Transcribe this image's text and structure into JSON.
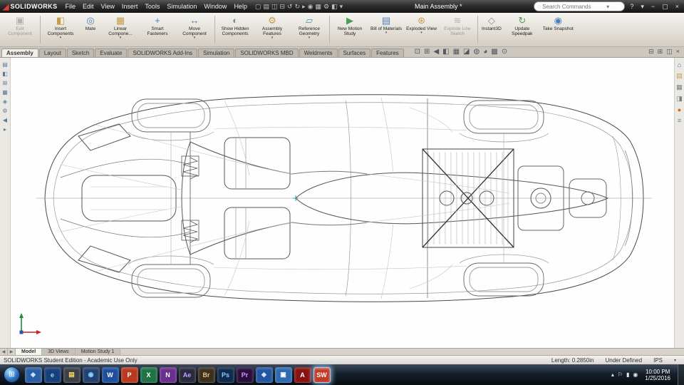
{
  "app": {
    "brand": "SOLIDWORKS",
    "title": "Main Assembly *"
  },
  "menubar": {
    "items": [
      "File",
      "Edit",
      "View",
      "Insert",
      "Tools",
      "Simulation",
      "Window",
      "Help"
    ]
  },
  "quickbar": {
    "icons": [
      {
        "name": "new",
        "glyph": "▢"
      },
      {
        "name": "open",
        "glyph": "▤"
      },
      {
        "name": "save",
        "glyph": "◫"
      },
      {
        "name": "print",
        "glyph": "⊟"
      },
      {
        "name": "undo",
        "glyph": "↺"
      },
      {
        "name": "redo",
        "glyph": "↻"
      },
      {
        "name": "select",
        "glyph": "▸"
      },
      {
        "name": "rebuild",
        "glyph": "◉"
      },
      {
        "name": "file-properties",
        "glyph": "▦"
      },
      {
        "name": "options",
        "glyph": "⚙"
      },
      {
        "name": "appearance",
        "glyph": "◧"
      },
      {
        "name": "more",
        "glyph": "▾"
      }
    ]
  },
  "search": {
    "placeholder": "Search Commands",
    "icon": "◌",
    "caret": "▾"
  },
  "window_controls": {
    "help": "?",
    "help_caret": "▾",
    "minimize": "−",
    "restore": "▢",
    "close": "×"
  },
  "ribbon": {
    "buttons": [
      {
        "label": "Edit Component",
        "glyph": "▣",
        "color": "#8a8f94"
      },
      {
        "label": "Insert Components",
        "glyph": "◧",
        "color": "#c79b4a"
      },
      {
        "label": "Mate",
        "glyph": "◎",
        "color": "#4a7ebb"
      },
      {
        "label": "Linear Compone...",
        "glyph": "▦",
        "color": "#c79b4a"
      },
      {
        "label": "Smart Fasteners",
        "glyph": "+",
        "color": "#4a7ebb"
      },
      {
        "label": "Move Component",
        "glyph": "↔",
        "color": "#4a7ebb"
      },
      {
        "label": "Show Hidden Components",
        "glyph": "◐",
        "color": "#7d8a99"
      },
      {
        "label": "Assembly Features",
        "glyph": "⚙",
        "color": "#c79b4a"
      },
      {
        "label": "Reference Geometry",
        "glyph": "▱",
        "color": "#3f9bb3"
      },
      {
        "label": "New Motion Study",
        "glyph": "▶",
        "color": "#4a9e5c"
      },
      {
        "label": "Bill of Materials",
        "glyph": "▤",
        "color": "#4a7ebb"
      },
      {
        "label": "Exploded View",
        "glyph": "⊛",
        "color": "#c79b4a"
      },
      {
        "label": "Explode Line Sketch",
        "glyph": "≋",
        "color": "#9aa0a6"
      },
      {
        "label": "Instant3D",
        "glyph": "◇",
        "color": "#8a8f94"
      },
      {
        "label": "Update Speedpak",
        "glyph": "↻",
        "color": "#4a9e5c"
      },
      {
        "label": "Take Snapshot",
        "glyph": "◉",
        "color": "#4a7ebb"
      }
    ]
  },
  "tabs": {
    "items": [
      "Assembly",
      "Layout",
      "Sketch",
      "Evaluate",
      "SOLIDWORKS Add-Ins",
      "Simulation",
      "SOLIDWORKS MBD",
      "Weldments",
      "Surfaces",
      "Features"
    ]
  },
  "headsup": {
    "icons": [
      {
        "name": "zoom-fit",
        "glyph": "⊡"
      },
      {
        "name": "zoom-area",
        "glyph": "⊞"
      },
      {
        "name": "previous-view",
        "glyph": "◀"
      },
      {
        "name": "section-view",
        "glyph": "◧"
      },
      {
        "name": "view-orientation",
        "glyph": "▦"
      },
      {
        "name": "display-style",
        "glyph": "◪"
      },
      {
        "name": "hide-show-items",
        "glyph": "◍"
      },
      {
        "name": "edit-appearance",
        "glyph": "◕"
      },
      {
        "name": "apply-scene",
        "glyph": "▩"
      },
      {
        "name": "view-settings",
        "glyph": "⊙"
      }
    ]
  },
  "frame_controls": {
    "icons": [
      {
        "name": "split-horizontal",
        "glyph": "⊟"
      },
      {
        "name": "split-vertical",
        "glyph": "⊞"
      },
      {
        "name": "viewport-layout",
        "glyph": "◫"
      },
      {
        "name": "close-view",
        "glyph": "×"
      }
    ]
  },
  "left_strip": {
    "icons": [
      {
        "name": "featuremanager-tree",
        "glyph": "▤"
      },
      {
        "name": "propertymanager",
        "glyph": "◧"
      },
      {
        "name": "configuration-manager",
        "glyph": "⊞"
      },
      {
        "name": "dimxpert-manager",
        "glyph": "▦"
      },
      {
        "name": "display-manager",
        "glyph": "◈"
      },
      {
        "name": "pane-settings",
        "glyph": "⚙"
      },
      {
        "name": "collapse-pane",
        "glyph": "◀"
      },
      {
        "name": "expand-pane",
        "glyph": "▸"
      }
    ]
  },
  "right_strip": {
    "icons": [
      {
        "name": "task-pane-resources",
        "glyph": "⌂",
        "color": "#3f72b5"
      },
      {
        "name": "design-library",
        "glyph": "▤",
        "color": "#c79b4a"
      },
      {
        "name": "file-explorer",
        "glyph": "▦",
        "color": "#7a7f85"
      },
      {
        "name": "view-palette",
        "glyph": "◨",
        "color": "#7a7f85"
      },
      {
        "name": "appearances-scenes",
        "glyph": "●",
        "color": "#d2691e"
      },
      {
        "name": "custom-properties",
        "glyph": "≡",
        "color": "#7a7f85"
      }
    ]
  },
  "model_tabs": {
    "nav_left": "◀",
    "nav_right": "▶",
    "items": [
      "Model",
      "3D Views",
      "Motion Study 1"
    ]
  },
  "statusbar": {
    "edition": "SOLIDWORKS Student Edition - Academic Use Only",
    "length": "Length: 0.2850in",
    "state": "Under Defined",
    "units": "IPS",
    "units_caret": "▾"
  },
  "taskbar": {
    "start_glyph": "⊞",
    "items": [
      {
        "name": "pinned-app",
        "label": "◆",
        "bg": "#2b5fa3",
        "fg": "#bfe0ff"
      },
      {
        "name": "internet-explorer",
        "label": "e",
        "bg": "#173f7a",
        "fg": "#9fd4ff"
      },
      {
        "name": "windows-explorer",
        "label": "▤",
        "bg": "#3b3f46",
        "fg": "#ffd76e"
      },
      {
        "name": "media-player",
        "label": "◉",
        "bg": "#24406e",
        "fg": "#8fd0ff"
      },
      {
        "name": "word",
        "label": "W",
        "bg": "#1f4e9e",
        "fg": "#ffffff"
      },
      {
        "name": "powerpoint",
        "label": "P",
        "bg": "#b73a1e",
        "fg": "#ffffff"
      },
      {
        "name": "excel",
        "label": "X",
        "bg": "#1f7246",
        "fg": "#ffffff"
      },
      {
        "name": "onenote",
        "label": "N",
        "bg": "#6a2e8e",
        "fg": "#ffffff"
      },
      {
        "name": "after-effects",
        "label": "Ae",
        "bg": "#2a2a3d",
        "fg": "#b8a3ff"
      },
      {
        "name": "bridge",
        "label": "Br",
        "bg": "#3d2f1e",
        "fg": "#e0c48a"
      },
      {
        "name": "photoshop",
        "label": "Ps",
        "bg": "#0e2a4d",
        "fg": "#8ecbff"
      },
      {
        "name": "premiere",
        "label": "Pr",
        "bg": "#2a0e3d",
        "fg": "#d39cff"
      },
      {
        "name": "edrawings",
        "label": "◆",
        "bg": "#2456a0",
        "fg": "#cfe4ff"
      },
      {
        "name": "pinned-app-2",
        "label": "▣",
        "bg": "#2d6ab0",
        "fg": "#ffffff"
      },
      {
        "name": "acrobat",
        "label": "A",
        "bg": "#8a1111",
        "fg": "#ffffff"
      },
      {
        "name": "solidworks",
        "label": "SW",
        "bg": "#c23b22",
        "fg": "#ffffff"
      }
    ],
    "tray": {
      "expand": "▴",
      "icons": [
        "⚐",
        "▮",
        "◉"
      ],
      "time": "10:00 PM",
      "date": "1/25/2016"
    }
  }
}
